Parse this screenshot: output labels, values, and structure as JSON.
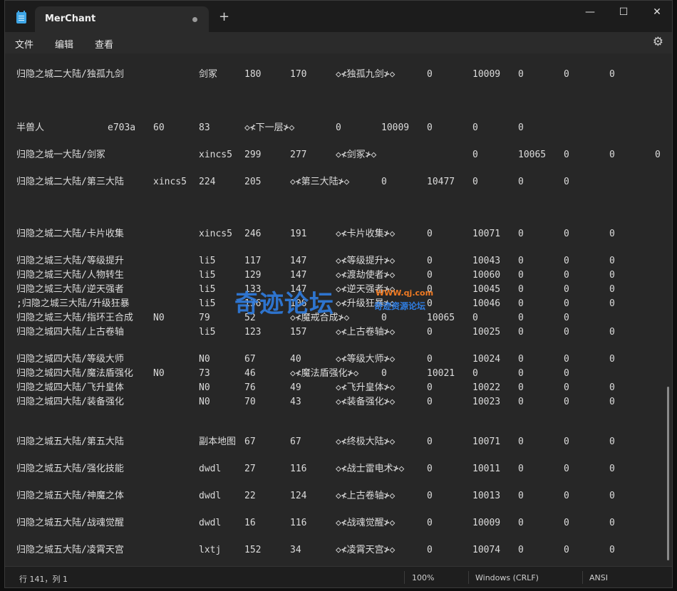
{
  "window": {
    "tab_title": "MerChant",
    "new_tab": "+",
    "minimize": "—",
    "maximize": "☐",
    "close": "✕"
  },
  "menu": {
    "items": [
      "文件",
      "编辑",
      "查看"
    ]
  },
  "rows": [
    [
      "归隐之城二大陆/独孤九剑",
      "剑冢",
      "180",
      "170",
      "◇≮独孤九剑≯◇",
      "0",
      "10009",
      "0",
      "0",
      "0"
    ],
    [
      "半兽人",
      "e703a",
      "60",
      "83",
      "◇≮下一层≯◇",
      "0",
      "10009",
      "0",
      "0",
      "0"
    ],
    [
      "归隐之城一大陆/剑冢",
      "xincs5",
      "299",
      "277",
      "◇≮剑冢≯◇",
      "",
      "0",
      "10065",
      "0",
      "0",
      "0"
    ],
    [
      "归隐之城二大陆/第三大陆",
      "xincs5",
      "224",
      "205",
      "◇≮第三大陆≯◇",
      "0",
      "10477",
      "0",
      "0",
      "0"
    ],
    [
      "归隐之城二大陆/卡片收集",
      "xincs5",
      "246",
      "191",
      "◇≮卡片收集≯◇",
      "0",
      "10071",
      "0",
      "0",
      "0"
    ],
    [
      "归隐之城三大陆/等级提升",
      "li5",
      "117",
      "147",
      "◇≮等级提升≯◇",
      "0",
      "10043",
      "0",
      "0",
      "0"
    ],
    [
      "归隐之城三大陆/人物转生",
      "li5",
      "129",
      "147",
      "◇≮渡劫使者≯◇",
      "0",
      "10060",
      "0",
      "0",
      "0"
    ],
    [
      "归隐之城三大陆/逆天强者",
      "li5",
      "133",
      "147",
      "◇≮逆天强者≯◇",
      "0",
      "10045",
      "0",
      "0",
      "0"
    ],
    [
      ";归隐之城三大陆/升级狂暴",
      "li5",
      "136",
      "106",
      "◇≮升级狂暴≯◇",
      "0",
      "10046",
      "0",
      "0",
      "0"
    ],
    [
      "归隐之城三大陆/指环王合成",
      "N0",
      "79",
      "52",
      "◇≮魔戒合成≯◇",
      "0",
      "10065",
      "0",
      "0",
      "0"
    ],
    [
      "归隐之城四大陆/上古卷轴",
      "li5",
      "123",
      "157",
      "◇≮上古卷轴≯◇",
      "0",
      "10025",
      "0",
      "0",
      "0"
    ],
    [
      "归隐之城四大陆/等级大师",
      "N0",
      "67",
      "40",
      "◇≮等级大师≯◇",
      "0",
      "10024",
      "0",
      "0",
      "0"
    ],
    [
      "归隐之城四大陆/魔法盾强化",
      "N0",
      "73",
      "46",
      "◇≮魔法盾强化≯◇",
      "0",
      "10021",
      "0",
      "0",
      "0"
    ],
    [
      "归隐之城四大陆/飞升皇体",
      "N0",
      "76",
      "49",
      "◇≮飞升皇体≯◇",
      "0",
      "10022",
      "0",
      "0",
      "0"
    ],
    [
      "归隐之城四大陆/装备强化",
      "N0",
      "70",
      "43",
      "◇≮装备强化≯◇",
      "0",
      "10023",
      "0",
      "0",
      "0"
    ],
    [
      "归隐之城五大陆/第五大陆",
      "副本地图",
      "67",
      "67",
      "◇≮终极大陆≯◇",
      "0",
      "10071",
      "0",
      "0",
      "0"
    ],
    [
      "归隐之城五大陆/强化技能",
      "dwdl",
      "27",
      "116",
      "◇≮战士雷电术≯◇",
      "0",
      "10011",
      "0",
      "0",
      "0"
    ],
    [
      "归隐之城五大陆/神魔之体",
      "dwdl",
      "22",
      "124",
      "◇≮上古卷轴≯◇",
      "0",
      "10013",
      "0",
      "0",
      "0"
    ],
    [
      "归隐之城五大陆/战魂觉醒",
      "dwdl",
      "16",
      "116",
      "◇≮战魂觉醒≯◇",
      "0",
      "10009",
      "0",
      "0",
      "0"
    ],
    [
      "归隐之城五大陆/凌霄天宫",
      "lxtj",
      "152",
      "34",
      "◇≮凌霄天宫≯◇",
      "0",
      "10074",
      "0",
      "0",
      "0"
    ]
  ],
  "status": {
    "position": "行 141，列 1",
    "zoom": "100%",
    "line_ending": "Windows (CRLF)",
    "encoding": "ANSI"
  },
  "watermark": {
    "main": "奇迹论坛",
    "site": "WWW.qj.com",
    "sub": "奇迹资源论坛"
  }
}
